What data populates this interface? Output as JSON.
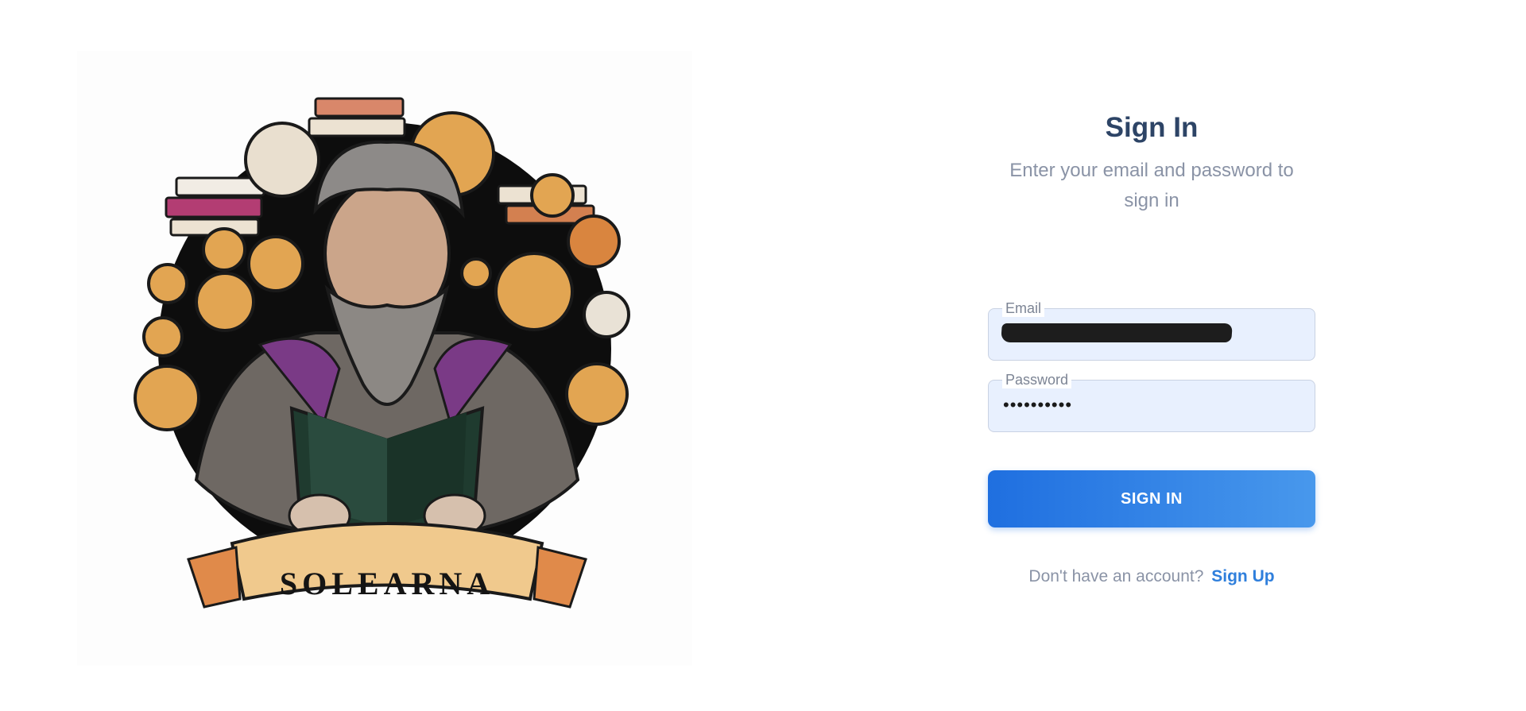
{
  "hero": {
    "banner_text": "SOLEARNA"
  },
  "signin": {
    "title": "Sign In",
    "subtitle": "Enter your email and password to sign in",
    "email_label": "Email",
    "password_label": "Password",
    "password_value": "••••••••••",
    "button_label": "SIGN IN"
  },
  "signup": {
    "prompt": "Don't have an account?",
    "link_label": "Sign Up"
  },
  "colors": {
    "title": "#2d4466",
    "muted_text": "#8a93a6",
    "input_bg": "#e8f0fe",
    "button_start": "#1f6fe0",
    "button_end": "#4898ec",
    "link": "#2f7fdc",
    "coin": "#e2a552",
    "robe": "#7a3a86"
  }
}
